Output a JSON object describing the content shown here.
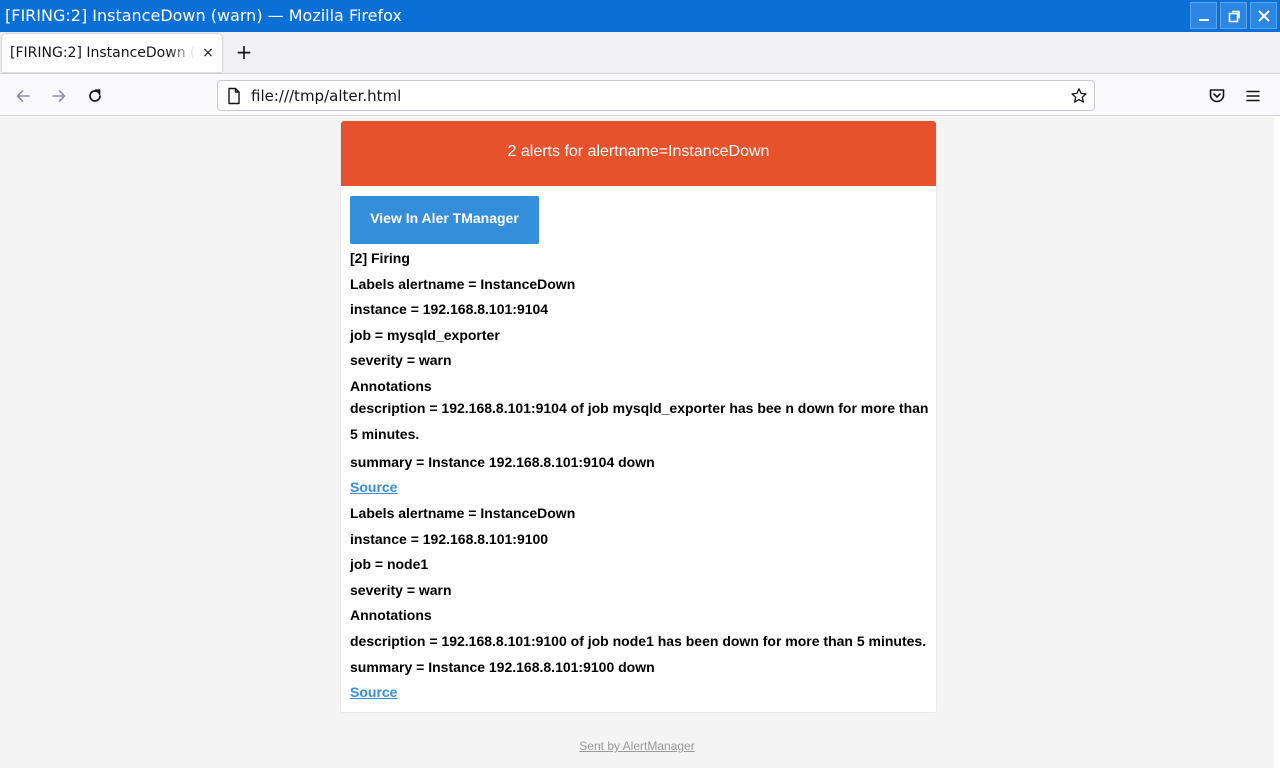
{
  "window": {
    "title": "[FIRING:2] InstanceDown (warn) — Mozilla Firefox",
    "minimize_icon": "minimize-icon",
    "maximize_icon": "maximize-icon",
    "close_icon": "close-icon",
    "titlebar_color": "#0a6fd6"
  },
  "tabs": [
    {
      "label": "[FIRING:2] InstanceDown (warn)",
      "close_symbol": "×",
      "active": true
    }
  ],
  "new_tab_symbol": "+",
  "navbar": {
    "url": "file:///tmp/alter.html"
  },
  "email": {
    "header": "2 alerts for alertname=InstanceDown",
    "header_color": "#e6522c",
    "view_button": "View In Aler TManager",
    "button_color": "#348eda",
    "firing": "[2] Firing",
    "alerts": [
      {
        "labels_alertname": "Labels alertname = InstanceDown",
        "instance": "instance = 192.168.8.101:9104",
        "job": "job = mysqld_exporter",
        "severity": "severity = warn",
        "annotations": "Annotations",
        "description": "description = 192.168.8.101:9104 of job mysqld_exporter has bee n down for more than 5 minutes.",
        "summary": "summary = Instance 192.168.8.101:9104 down",
        "source": "Source"
      },
      {
        "labels_alertname": "Labels alertname = InstanceDown",
        "instance": "instance = 192.168.8.101:9100",
        "job": "job = node1",
        "severity": "severity = warn",
        "annotations": "Annotations",
        "description": "description = 192.168.8.101:9100 of job node1 has been down for more than 5 minutes.",
        "summary": "summary = Instance 192.168.8.101:9100 down",
        "source": "Source"
      }
    ]
  },
  "footer": "Sent by AlertManager"
}
